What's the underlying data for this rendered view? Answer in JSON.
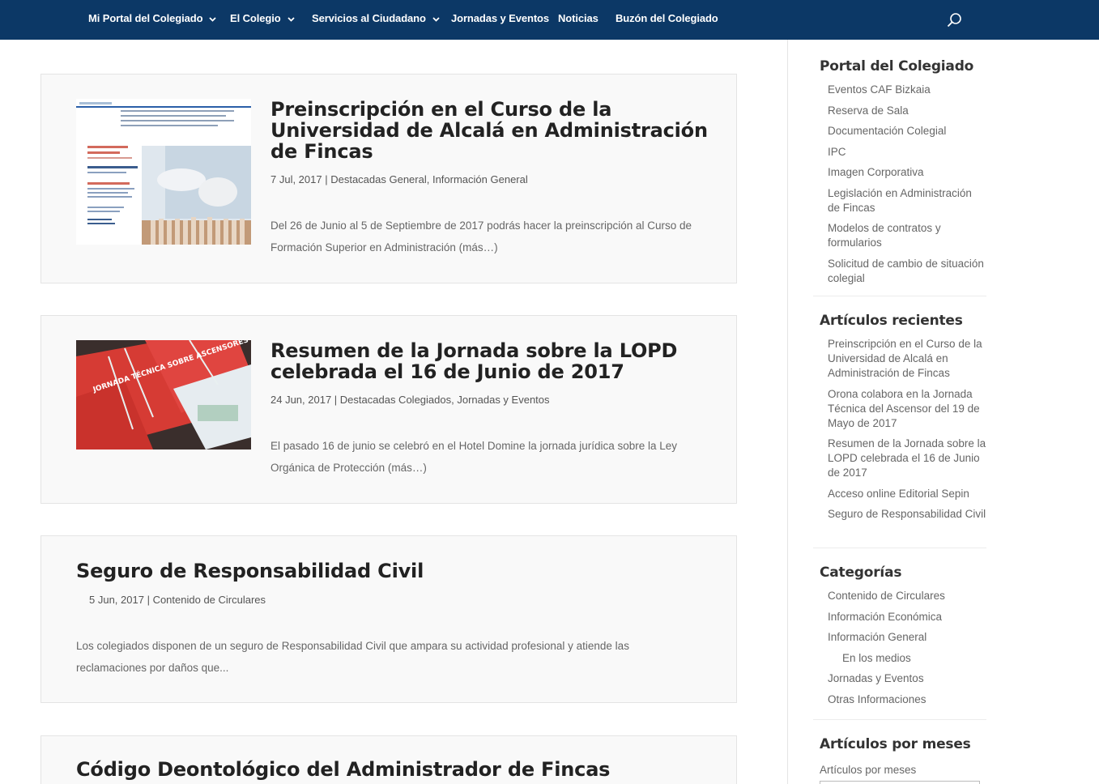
{
  "nav": {
    "items": [
      {
        "label": "Mi Portal del Colegiado",
        "dropdown": true
      },
      {
        "label": "El Colegio",
        "dropdown": true
      },
      {
        "label": "Servicios al Ciudadano",
        "dropdown": true
      },
      {
        "label": "Jornadas y Eventos",
        "dropdown": false
      },
      {
        "label": "Noticias",
        "dropdown": false
      },
      {
        "label": "Buzón del Colegiado",
        "dropdown": false
      }
    ],
    "search_icon": "search-icon",
    "bg_color": "#0c3866"
  },
  "posts": [
    {
      "title": "Preinscripción en el Curso de la Universidad de Alcalá en Administración de Fincas",
      "date": "7 Jul, 2017",
      "categories": [
        "Destacadas General",
        "Información General"
      ],
      "excerpt": "Del 26 de Junio al 5 de Septiembre de 2017 podrás hacer la preinscripción al Curso de Formación Superior en Administración (más…)",
      "thumbnail": "brochure-image"
    },
    {
      "title": "Resumen de la Jornada sobre la LOPD celebrada el 16 de Junio de 2017",
      "date": "24 Jun, 2017",
      "categories": [
        "Destacadas Colegiados",
        "Jornadas y Eventos"
      ],
      "excerpt": "El pasado 16 de junio se celebró en el Hotel Domine la jornada jurídica sobre la Ley Orgánica de Protección (más…)",
      "thumbnail": "booklets-image",
      "thumb_text": "JORNADA TÉCNICA SOBRE ASCENSORES"
    },
    {
      "title": "Seguro de Responsabilidad Civil",
      "date": "5 Jun, 2017",
      "categories": [
        "Contenido de Circulares"
      ],
      "excerpt": "Los colegiados disponen de un seguro de Responsabilidad Civil que ampara su actividad profesional y atiende las reclamaciones por daños que..."
    },
    {
      "title": "Código Deontológico del Administrador de Fincas"
    }
  ],
  "sidebar": {
    "portal": {
      "title": "Portal del Colegiado",
      "items": [
        "Eventos CAF Bizkaia",
        "Reserva de Sala",
        "Documentación Colegial",
        "IPC",
        "Imagen Corporativa",
        "Legislación en Administración de Fincas",
        "Modelos de contratos y formularios",
        "Solicitud de cambio de situación colegial"
      ]
    },
    "recent": {
      "title": "Artículos recientes",
      "items": [
        "Preinscripción en el Curso de la Universidad de Alcalá en Administración de Fincas",
        "Orona colabora en la Jornada Técnica del Ascensor del 19 de Mayo de 2017",
        "Resumen de la Jornada sobre la LOPD celebrada el 16 de Junio de 2017",
        "Acceso online Editorial Sepin",
        "Seguro de Responsabilidad Civil"
      ]
    },
    "categories": {
      "title": "Categorías",
      "items": [
        "Contenido de Circulares",
        "Información Económica",
        "Información General",
        "En los medios",
        "Jornadas y Eventos",
        "Otras Informaciones"
      ]
    },
    "archive": {
      "title": "Artículos por meses",
      "label": "Artículos por meses"
    }
  }
}
